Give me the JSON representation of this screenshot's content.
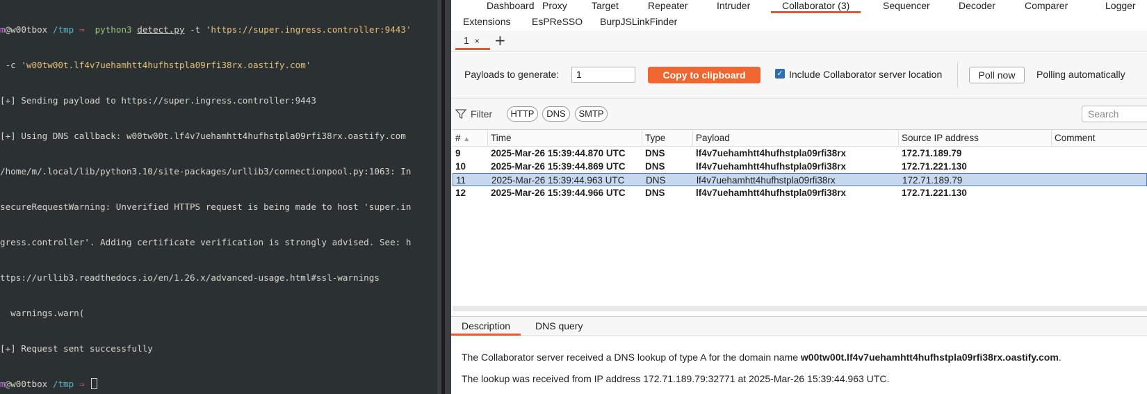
{
  "terminal": {
    "prompt_user": "m",
    "prompt_host": "@w00tbox",
    "prompt_dir": "/tmp",
    "prompt_arrow": "⇒",
    "cmd_name": "python3",
    "cmd_script": "detect.py",
    "cmd_flag_t": "-t",
    "cmd_target": "'https://super.ingress.controller:9443'",
    "cmd_flag_c": "-c",
    "cmd_callback": "'w00tw00t.lf4v7uehamhtt4hufhstpla09rfi38rx.oastify.com'",
    "output": [
      "[+] Sending payload to https://super.ingress.controller:9443",
      "[+] Using DNS callback: w00tw00t.lf4v7uehamhtt4hufhstpla09rfi38rx.oastify.com",
      "/home/m/.local/lib/python3.10/site-packages/urllib3/connectionpool.py:1063: In",
      "secureRequestWarning: Unverified HTTPS request is being made to host 'super.in",
      "gress.controller'. Adding certificate verification is strongly advised. See: h",
      "ttps://urllib3.readthedocs.io/en/1.26.x/advanced-usage.html#ssl-warnings",
      "  warnings.warn(",
      "[+] Request sent successfully"
    ]
  },
  "burp": {
    "tabs_row1": [
      "Dashboard",
      "Proxy",
      "Target",
      "Repeater",
      "Intruder",
      "Collaborator (3)",
      "Sequencer",
      "Decoder",
      "Comparer",
      "Logger"
    ],
    "tabs_row2": [
      "Extensions",
      "EsPReSSO",
      "BurpJSLinkFinder"
    ],
    "subtab_label": "1",
    "subtab_close": "×",
    "add_tab": "+",
    "payloads_label": "Payloads to generate:",
    "payloads_value": "1",
    "copy_button": "Copy to clipboard",
    "include_label": "Include Collaborator server location",
    "poll_button": "Poll now",
    "polling_label": "Polling automatically",
    "filter_label": "Filter",
    "filters": [
      "HTTP",
      "DNS",
      "SMTP"
    ],
    "search_placeholder": "Search",
    "columns": [
      "#",
      "Time",
      "Type",
      "Payload",
      "Source IP address",
      "Comment"
    ],
    "rows": [
      {
        "n": "9",
        "time": "2025-Mar-26 15:39:44.870 UTC",
        "type": "DNS",
        "payload": "lf4v7uehamhtt4hufhstpla09rfi38rx",
        "ip": "172.71.189.79"
      },
      {
        "n": "10",
        "time": "2025-Mar-26 15:39:44.869 UTC",
        "type": "DNS",
        "payload": "lf4v7uehamhtt4hufhstpla09rfi38rx",
        "ip": "172.71.221.130"
      },
      {
        "n": "11",
        "time": "2025-Mar-26 15:39:44.963 UTC",
        "type": "DNS",
        "payload": "lf4v7uehamhtt4hufhstpla09rfi38rx",
        "ip": "172.71.189.79"
      },
      {
        "n": "12",
        "time": "2025-Mar-26 15:39:44.966 UTC",
        "type": "DNS",
        "payload": "lf4v7uehamhtt4hufhstpla09rfi38rx",
        "ip": "172.71.221.130"
      }
    ],
    "detail_tabs": [
      "Description",
      "DNS query"
    ],
    "detail_line1_pre": "The Collaborator server received a DNS lookup of type A for the domain name ",
    "detail_line1_domain": "w00tw00t.lf4v7uehamhtt4hufhstpla09rfi38rx.oastify.com",
    "detail_line1_post": ".",
    "detail_line2": "The lookup was received from IP address 172.71.189.79:32771 at 2025-Mar-26 15:39:44.963 UTC."
  }
}
